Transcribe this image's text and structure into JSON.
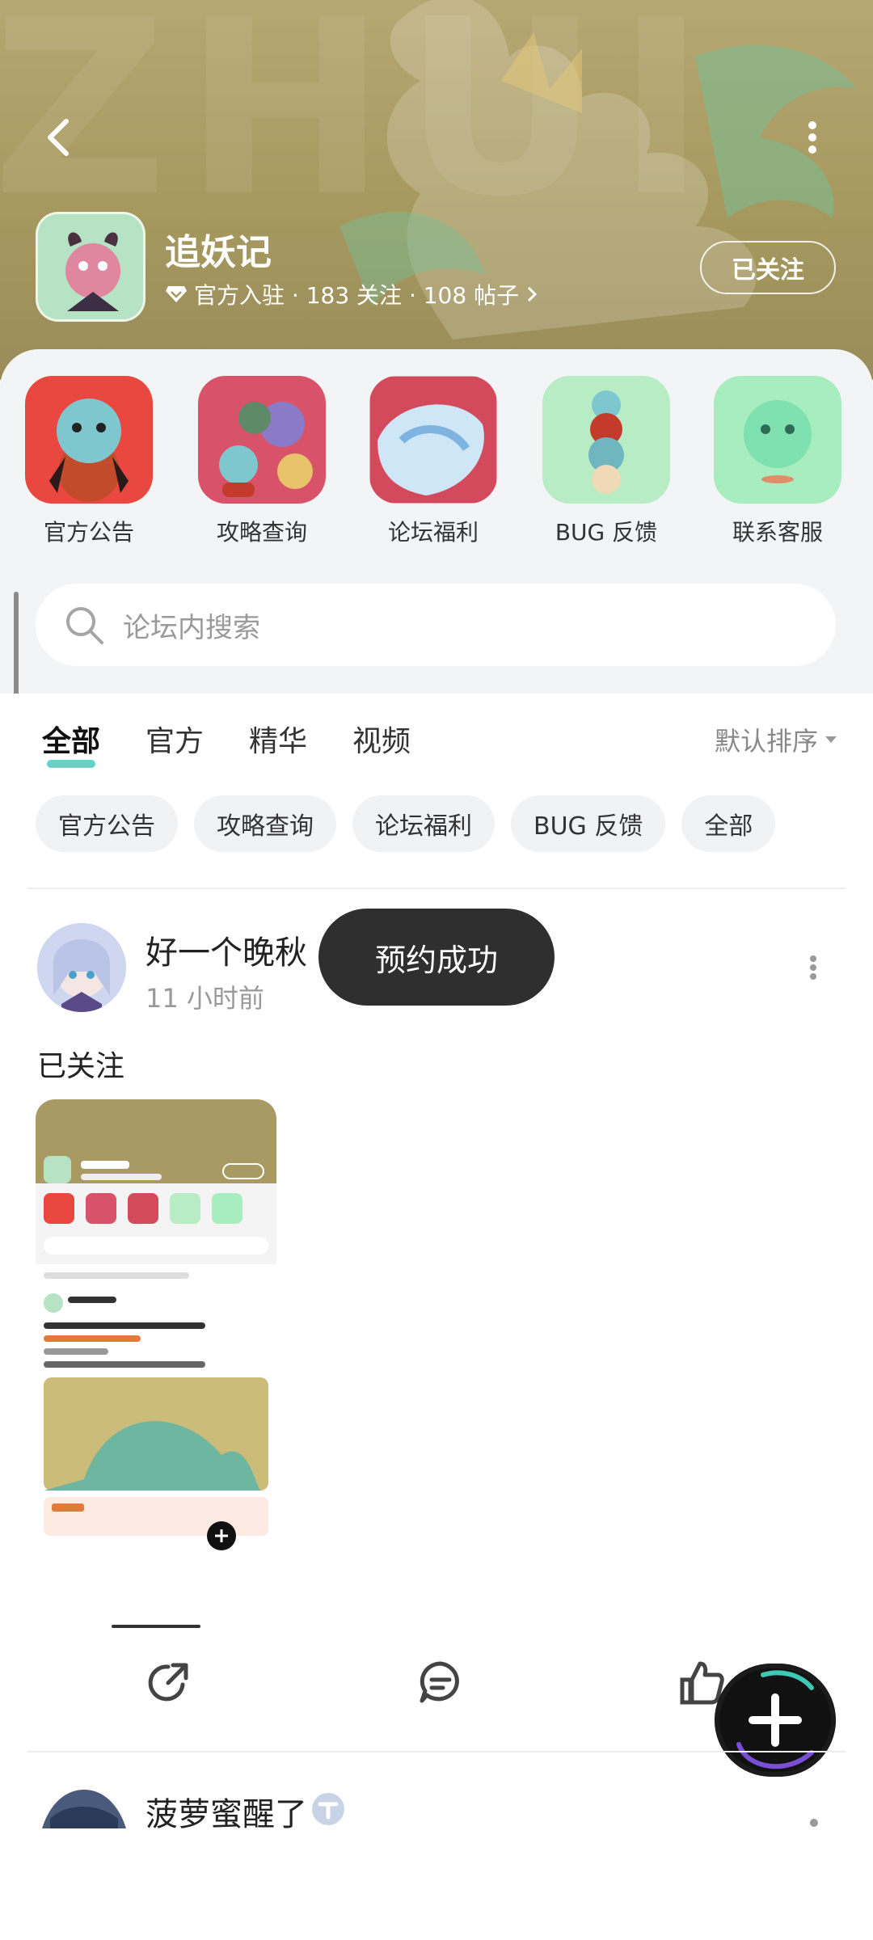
{
  "header": {
    "app_name": "追妖记",
    "meta": "官方入驻 · 183 关注 · 108 帖子",
    "follow_label": "已关注"
  },
  "shortcuts": [
    {
      "label": "官方公告"
    },
    {
      "label": "攻略查询"
    },
    {
      "label": "论坛福利"
    },
    {
      "label": "BUG 反馈"
    },
    {
      "label": "联系客服"
    }
  ],
  "search": {
    "placeholder": "论坛内搜索"
  },
  "tabs": [
    {
      "label": "全部",
      "active": true
    },
    {
      "label": "官方"
    },
    {
      "label": "精华"
    },
    {
      "label": "视频"
    }
  ],
  "sort_label": "默认排序",
  "chips": [
    "官方公告",
    "攻略查询",
    "论坛福利",
    "BUG 反馈",
    "全部"
  ],
  "post": {
    "author": "好一个晚秋",
    "time": "11 小时前",
    "text": "已关注"
  },
  "toast": "预约成功",
  "post2": {
    "author": "菠萝蜜醒了"
  },
  "colors": {
    "accent": "#4fd0c0",
    "hero": "#a6995f",
    "toast_bg": "#2f2f2f"
  }
}
